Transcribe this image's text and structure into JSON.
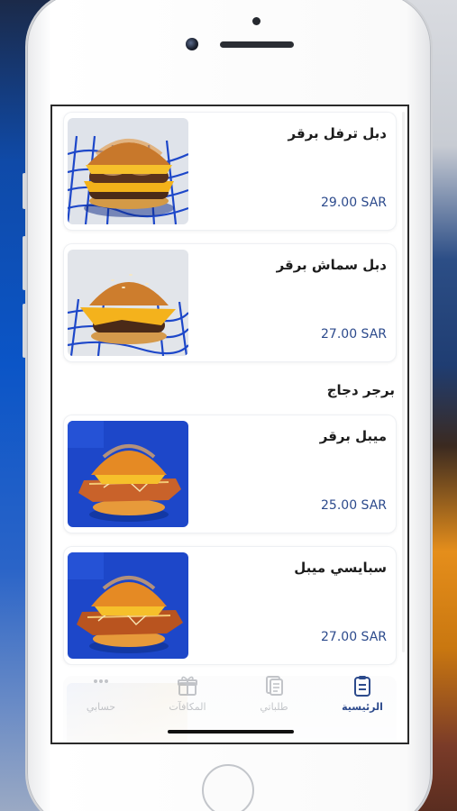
{
  "menu": {
    "items_top": [
      {
        "name": "دبل ترفل برقر",
        "price": "29.00 SAR",
        "image_icon": "double-truffle-burger-photo"
      },
      {
        "name": "دبل سماش برقر",
        "price": "27.00 SAR",
        "image_icon": "double-smash-burger-photo"
      }
    ],
    "section": {
      "title": "برجر دجاج"
    },
    "items_chicken": [
      {
        "name": "ميبل برقر",
        "price": "25.00 SAR",
        "image_icon": "maple-chicken-burger-photo"
      },
      {
        "name": "سبايسي ميبل",
        "price": "27.00 SAR",
        "image_icon": "spicy-maple-chicken-burger-photo"
      }
    ]
  },
  "tabbar": {
    "tabs": [
      {
        "label": "الرئيسية",
        "icon": "clipboard-icon",
        "active": true
      },
      {
        "label": "طلباتي",
        "icon": "document-icon",
        "active": false
      },
      {
        "label": "المكافآت",
        "icon": "gift-icon",
        "active": false
      },
      {
        "label": "حسابي",
        "icon": "more-dots-icon",
        "active": false
      }
    ]
  },
  "colors": {
    "accent": "#2c4a8c",
    "card_border": "#eef0f3",
    "thumb_blue": "#1d47c9"
  }
}
